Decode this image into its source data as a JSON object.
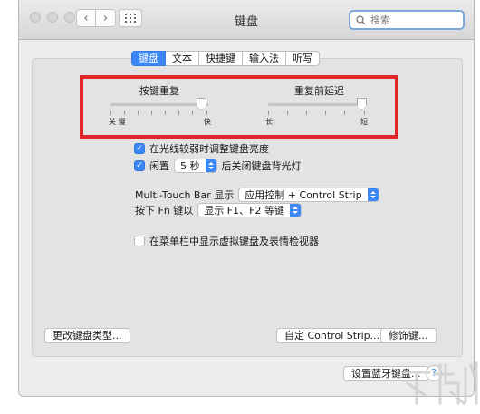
{
  "window": {
    "title": "键盘",
    "search_placeholder": "搜索"
  },
  "toolbar": {
    "back_icon": "chevron-left-icon",
    "forward_icon": "chevron-right-icon",
    "grid_icon": "grid-icon"
  },
  "tabs": [
    {
      "label": "键盘",
      "active": true
    },
    {
      "label": "文本",
      "active": false
    },
    {
      "label": "快捷键",
      "active": false
    },
    {
      "label": "输入法",
      "active": false
    },
    {
      "label": "听写",
      "active": false
    }
  ],
  "key_repeat": {
    "label": "按键重复",
    "left_label": "关 慢",
    "right_label": "快",
    "value": 1.0
  },
  "delay_until_repeat": {
    "label": "重复前延迟",
    "left_label": "长",
    "right_label": "短",
    "value": 1.0
  },
  "options": {
    "adjust_brightness": {
      "label": "在光线较弱时调整键盘亮度",
      "checked": true
    },
    "backlight_off": {
      "prefix": "闲置",
      "value": "5 秒",
      "suffix": "后关闭键盘背光灯",
      "checked": true
    }
  },
  "touch_bar": {
    "label": "Multi-Touch Bar 显示",
    "value": "应用控制 + Control Strip"
  },
  "fn_key": {
    "label": "按下 Fn 键以",
    "value": "显示 F1、F2 等键"
  },
  "menu_bar_viewer": {
    "label": "在菜单栏中显示虚拟键盘及表情检视器",
    "checked": false
  },
  "buttons": {
    "change_type": "更改键盘类型...",
    "customize_strip": "自定 Control Strip...",
    "modifier_keys": "修饰键...",
    "bluetooth": "设置蓝牙键盘...",
    "help": "?"
  },
  "colors": {
    "accent": "#3a87f5",
    "highlight_box": "#e0262a"
  }
}
